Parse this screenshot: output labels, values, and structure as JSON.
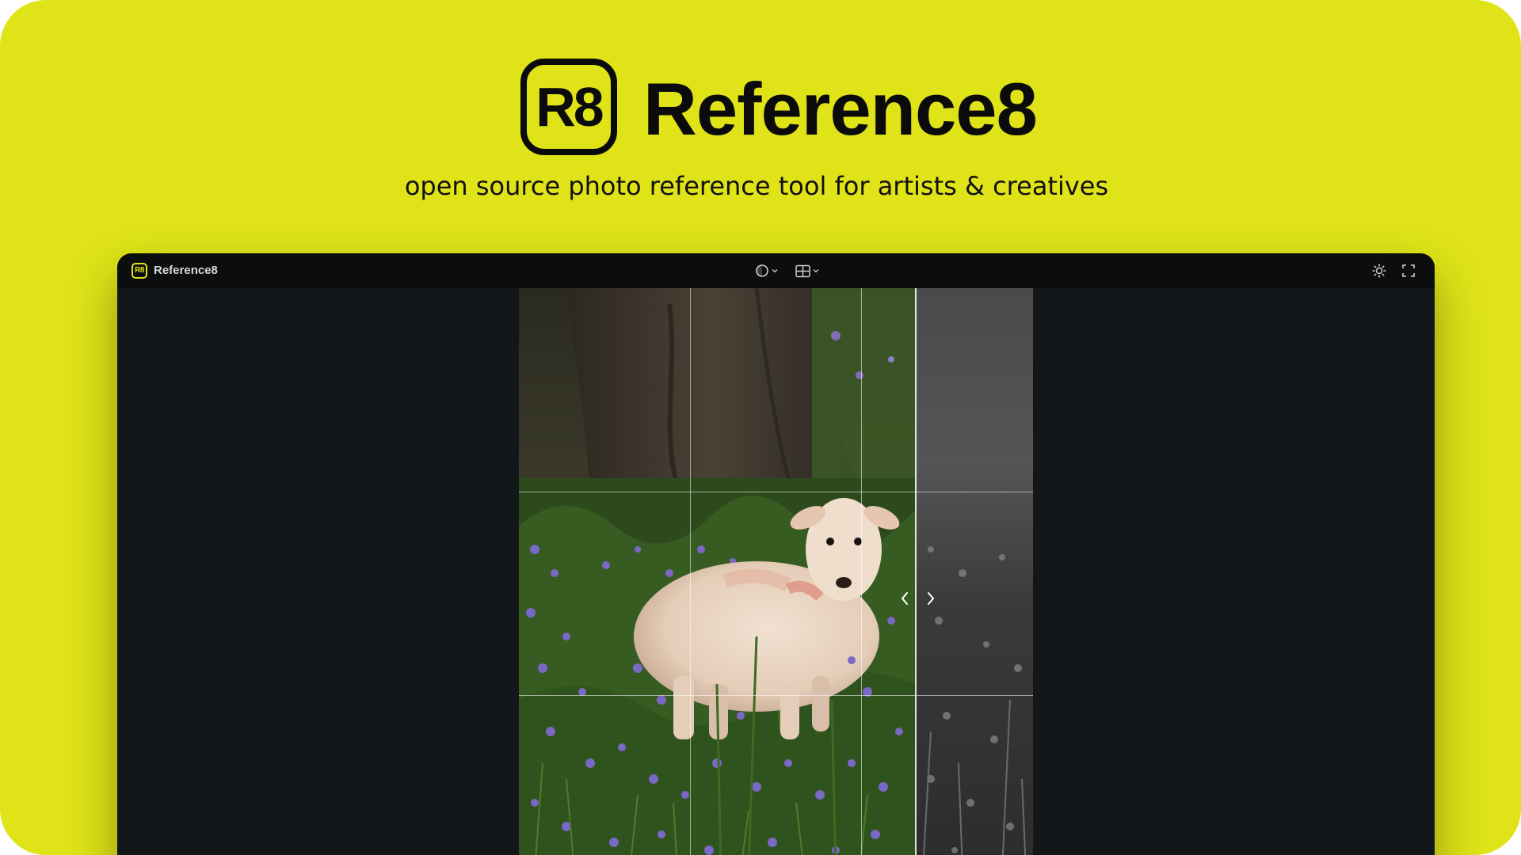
{
  "hero": {
    "logo_text": "R8",
    "title": "Reference8",
    "subtitle": "open source photo reference tool for artists & creatives"
  },
  "app": {
    "icon_text": "R8",
    "title": "Reference8",
    "toolbar": {
      "center": [
        {
          "icon": "circle-filter-icon",
          "menu": "chevron-down-icon"
        },
        {
          "icon": "grid-icon",
          "menu": "chevron-down-icon"
        }
      ],
      "right": [
        {
          "icon": "sun-icon"
        },
        {
          "icon": "fullscreen-icon"
        }
      ]
    },
    "viewer": {
      "grid": "3x3",
      "compare_split": "color | grayscale",
      "arrows": [
        "chevron-left-icon",
        "chevron-right-icon"
      ]
    }
  },
  "colors": {
    "brand_yellow": "#dfe318",
    "window_bg": "#14171a",
    "titlebar_bg": "#0c0d0f"
  }
}
